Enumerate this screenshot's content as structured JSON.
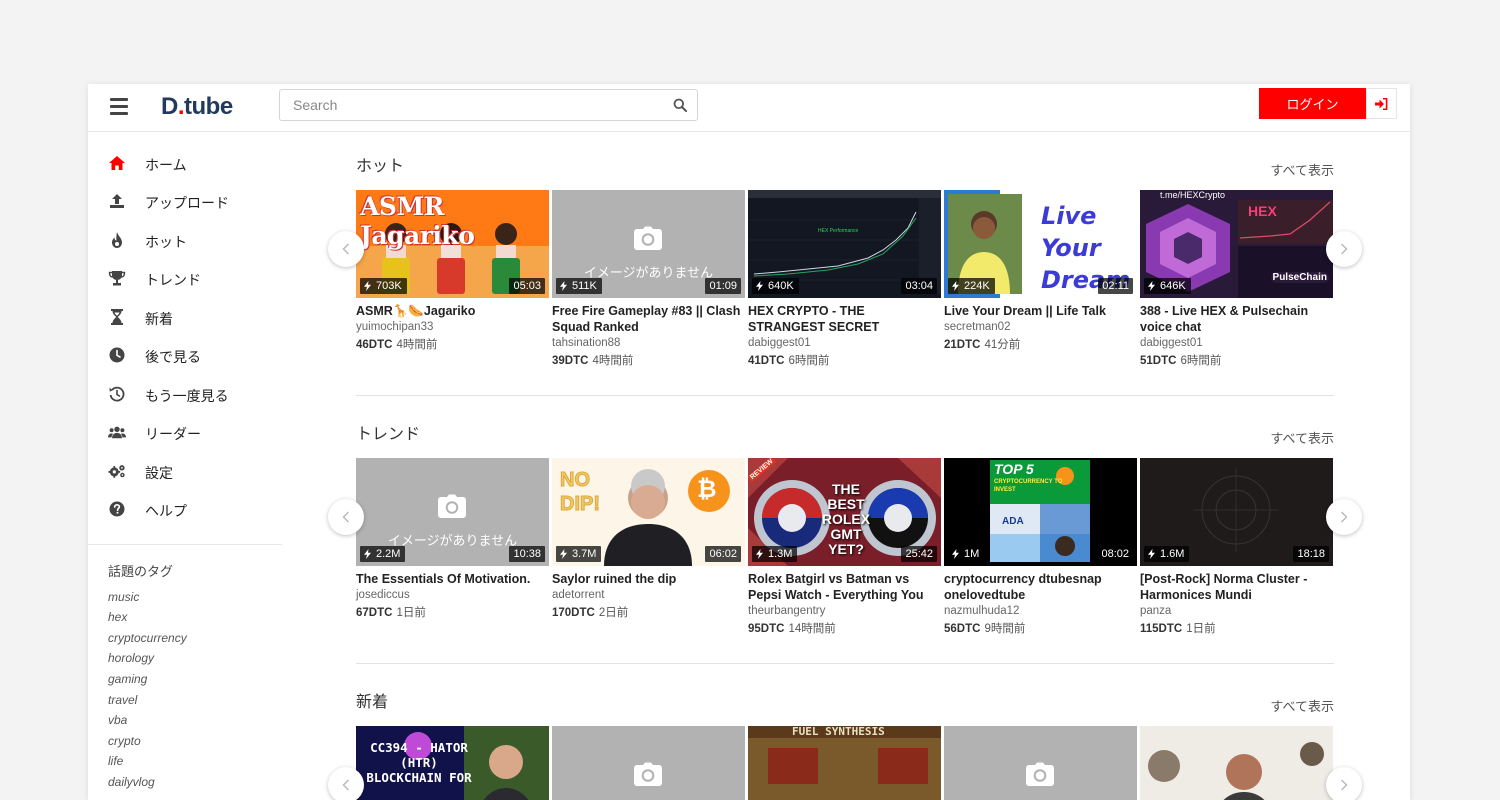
{
  "header": {
    "logo_main": "D",
    "logo_dot": ".",
    "logo_rest": "tube",
    "search_placeholder": "Search",
    "login_label": "ログイン"
  },
  "sidebar": {
    "items": [
      {
        "label": "ホーム",
        "icon": "home-icon"
      },
      {
        "label": "アップロード",
        "icon": "upload-icon"
      },
      {
        "label": "ホット",
        "icon": "fire-icon"
      },
      {
        "label": "トレンド",
        "icon": "trophy-icon"
      },
      {
        "label": "新着",
        "icon": "hourglass-icon"
      },
      {
        "label": "後で見る",
        "icon": "clock-icon"
      },
      {
        "label": "もう一度見る",
        "icon": "history-icon"
      },
      {
        "label": "リーダー",
        "icon": "users-icon"
      },
      {
        "label": "設定",
        "icon": "gears-icon"
      },
      {
        "label": "ヘルプ",
        "icon": "help-icon"
      }
    ],
    "tags_title": "話題のタグ",
    "tags": [
      "music",
      "hex",
      "cryptocurrency",
      "horology",
      "gaming",
      "travel",
      "vba",
      "crypto",
      "life",
      "dailyvlog"
    ]
  },
  "sections": [
    {
      "title": "ホット",
      "more": "すべて表示",
      "videos": [
        {
          "title": "ASMR🦒🌭Jagariko",
          "author": "yuimochipan33",
          "dtc": "46DTC",
          "time": "4時間前",
          "views": "703K",
          "duration": "05:03",
          "thumb": "jagariko",
          "overlay": "ASMR Jagariko"
        },
        {
          "title": "Free Fire Gameplay #83 || Clash Squad Ranked",
          "author": "tahsination88",
          "dtc": "39DTC",
          "time": "4時間前",
          "views": "511K",
          "duration": "01:09",
          "thumb": "none",
          "noimg": "イメージがありません"
        },
        {
          "title": "HEX CRYPTO - THE STRANGEST SECRET",
          "author": "dabiggest01",
          "dtc": "41DTC",
          "time": "6時間前",
          "views": "640K",
          "duration": "03:04",
          "thumb": "chart"
        },
        {
          "title": "Live Your Dream || Life Talk",
          "author": "secretman02",
          "dtc": "21DTC",
          "time": "41分前",
          "views": "224K",
          "duration": "02:11",
          "thumb": "dream",
          "overlay": "Live Your Dream"
        },
        {
          "title": "388 - Live HEX & Pulsechain voice chat",
          "author": "dabiggest01",
          "dtc": "51DTC",
          "time": "6時間前",
          "views": "646K",
          "duration": "",
          "thumb": "hex",
          "overlay": "HEX",
          "overlay2": "PulseChain",
          "overlay3": "t.me/HEXCrypto"
        }
      ]
    },
    {
      "title": "トレンド",
      "more": "すべて表示",
      "videos": [
        {
          "title": "The Essentials Of Motivation.",
          "author": "josediccus",
          "dtc": "67DTC",
          "time": "1日前",
          "views": "2.2M",
          "duration": "10:38",
          "thumb": "none",
          "noimg": "イメージがありません"
        },
        {
          "title": "Saylor ruined the dip",
          "author": "adetorrent",
          "dtc": "170DTC",
          "time": "2日前",
          "views": "3.7M",
          "duration": "06:02",
          "thumb": "saylor",
          "overlay": "NO DIP!"
        },
        {
          "title": "Rolex Batgirl vs Batman vs Pepsi Watch - Everything You Need To...",
          "author": "theurbangentry",
          "dtc": "95DTC",
          "time": "14時間前",
          "views": "1.3M",
          "duration": "25:42",
          "thumb": "rolex",
          "overlay": "THE BEST ROLEX GMT YET?",
          "overlay2": "REVIEW"
        },
        {
          "title": "cryptocurrency dtubesnap onelovedtube",
          "author": "nazmulhuda12",
          "dtc": "56DTC",
          "time": "9時間前",
          "views": "1M",
          "duration": "08:02",
          "thumb": "top5",
          "overlay": "TOP 5",
          "overlay2": "CRYPTOCURRENCY TO INVEST",
          "overlay3": "ADA"
        },
        {
          "title": "[Post-Rock] Norma Cluster - Harmonices Mundi",
          "author": "panza",
          "dtc": "115DTC",
          "time": "1日前",
          "views": "1.6M",
          "duration": "18:18",
          "thumb": "dark"
        }
      ]
    },
    {
      "title": "新着",
      "more": "すべて表示",
      "videos": [
        {
          "thumb": "hator",
          "overlay": "CC394 - HATOR (HTR) BLOCKCHAIN FOR"
        },
        {
          "thumb": "none"
        },
        {
          "thumb": "fuel",
          "overlay": "FUEL SYNTHESIS"
        },
        {
          "thumb": "none"
        },
        {
          "thumb": "room"
        }
      ]
    }
  ],
  "colors": {
    "accent": "#ff0000",
    "logo": "#223a5e"
  }
}
